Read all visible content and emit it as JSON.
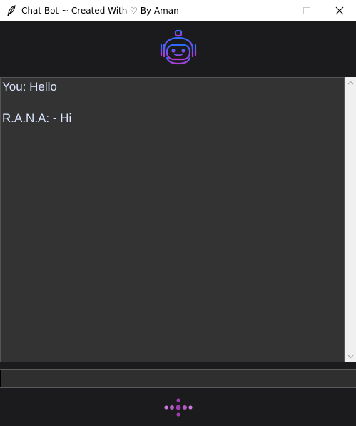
{
  "window": {
    "title": "Chat Bot ~ Created With ♡ By Aman",
    "app_icon": "feather-icon",
    "controls": [
      "minimize-icon",
      "maximize-icon",
      "close-icon"
    ]
  },
  "header": {
    "logo_icon": "robot-icon"
  },
  "chat": {
    "messages": [
      {
        "text": "You: Hello"
      },
      {
        "text": "R.A.N.A: - Hi"
      }
    ],
    "text_color": "#dce6ff",
    "background": "#333333"
  },
  "input": {
    "value": "",
    "placeholder": ""
  },
  "send_button": {
    "icon": "send-dots-icon",
    "color": "#9c3fae"
  },
  "colors": {
    "window_bg": "#1b1b1d",
    "accent_purple": "#9c3fae",
    "logo_gradient_start": "#2d6bff",
    "logo_gradient_end": "#b43cd8"
  }
}
